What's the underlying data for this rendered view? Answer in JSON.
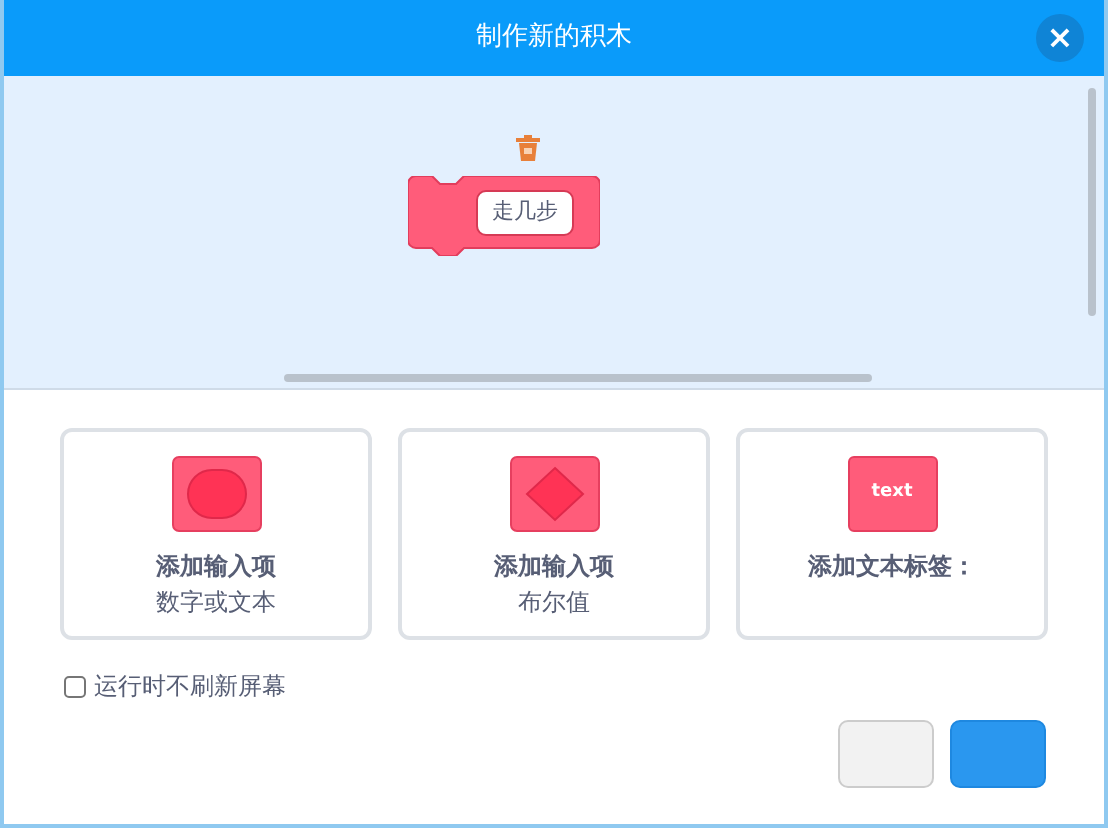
{
  "window": {
    "title": "制作新的积木",
    "close": "×"
  },
  "block": {
    "input_label": "走几步"
  },
  "options": [
    {
      "kind": "number",
      "title": "添加输入项",
      "subtitle": "数字或文本"
    },
    {
      "kind": "boolean",
      "title": "添加输入项",
      "subtitle": "布尔值"
    },
    {
      "kind": "label",
      "title": "添加文本标签：",
      "icon_text": "text"
    }
  ],
  "run_without_refresh": {
    "label": "运行时不刷新屏幕",
    "checked": false
  },
  "buttons": [
    {
      "kind": "secondary"
    },
    {
      "kind": "primary"
    }
  ]
}
